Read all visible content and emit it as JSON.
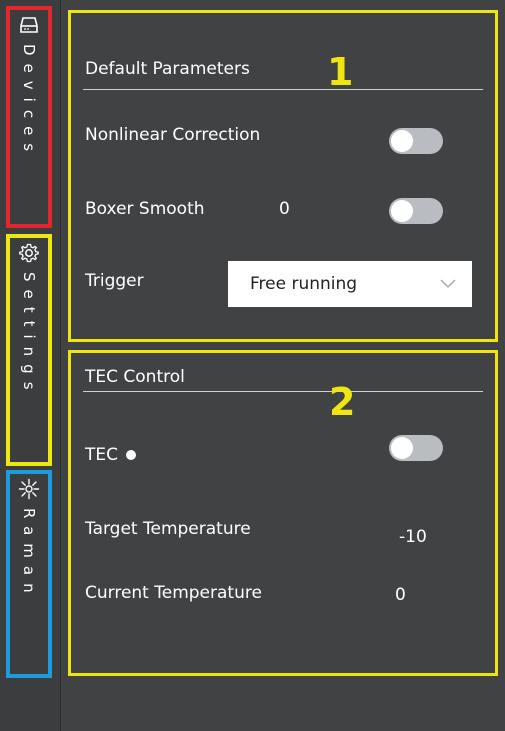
{
  "colors": {
    "background": "#404244",
    "rail": "#3b3d3f",
    "devices_border": "#e3262b",
    "settings_border": "#f0e60f",
    "raman_border": "#1e9bdc",
    "panel_border": "#f0e60f",
    "marker": "#f0e60f",
    "toggle_track": "#b9bcc0"
  },
  "rail": {
    "tabs": [
      {
        "label": "Devices",
        "icon": "hard-drive-icon"
      },
      {
        "label": "Settings",
        "icon": "gear-icon"
      },
      {
        "label": "Raman",
        "icon": "laser-burst-icon"
      }
    ]
  },
  "panel1": {
    "marker": "1",
    "header": "Default Parameters",
    "rows": {
      "nonlinear_correction": {
        "label": "Nonlinear Correction",
        "toggle_on": false
      },
      "boxer_smooth": {
        "label": "Boxer Smooth",
        "value": "0",
        "toggle_on": false
      },
      "trigger": {
        "label": "Trigger",
        "selected": "Free running"
      }
    }
  },
  "panel2": {
    "marker": "2",
    "header": "TEC Control",
    "rows": {
      "tec": {
        "label": "TEC",
        "toggle_on": false
      },
      "target_temperature": {
        "label": "Target Temperature",
        "value": "-10"
      },
      "current_temperature": {
        "label": "Current Temperature",
        "value": "0"
      }
    }
  }
}
